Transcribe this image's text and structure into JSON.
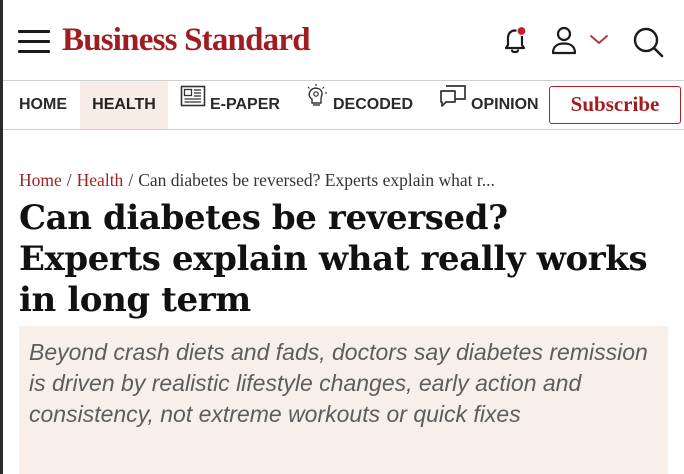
{
  "header": {
    "logo_text": "Business Standard",
    "brand_color": "#9f1d20",
    "icons": [
      "menu-icon",
      "bell-icon",
      "user-icon",
      "chevron-down-icon",
      "search-icon"
    ],
    "notification_dot_color": "#c8202a"
  },
  "nav": {
    "items": [
      {
        "label": "HOME"
      },
      {
        "label": "HEALTH",
        "active": true
      },
      {
        "label": "E-PAPER",
        "icon": "newspaper-icon"
      },
      {
        "label": "DECODED",
        "icon": "brain-bulb-icon"
      },
      {
        "label": "OPINION",
        "icon": "speech-bubble-icon"
      }
    ],
    "subscribe_label": "Subscribe"
  },
  "breadcrumb": {
    "home": "Home",
    "section": "Health",
    "current": "Can diabetes be reversed? Experts explain what r..."
  },
  "article": {
    "headline": "Can diabetes be reversed? Experts explain what really works in long term",
    "summary": "Beyond crash diets and fads, doctors say diabetes remission is driven by realistic lifestyle changes, early action and consistency, not extreme workouts or quick fixes"
  }
}
